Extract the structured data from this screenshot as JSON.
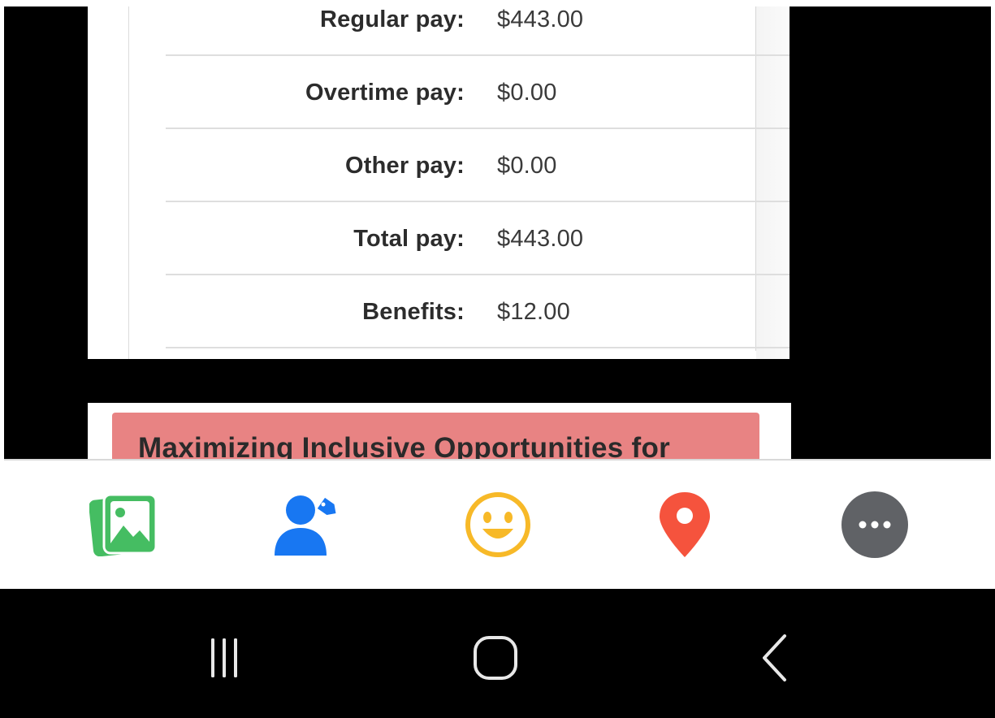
{
  "pay_details": {
    "rows": [
      {
        "label": "Regular pay:",
        "value": "$443.00"
      },
      {
        "label": "Overtime pay:",
        "value": "$0.00"
      },
      {
        "label": "Other pay:",
        "value": "$0.00"
      },
      {
        "label": "Total pay:",
        "value": "$443.00"
      },
      {
        "label": "Benefits:",
        "value": "$12.00"
      }
    ]
  },
  "next_card": {
    "banner_title": "Maximizing Inclusive Opportunities for",
    "banner_color": "#e88383"
  },
  "composer_toolbar": {
    "items": [
      {
        "icon": "photo-gallery-icon",
        "color": "#45bd62"
      },
      {
        "icon": "tag-people-icon",
        "color": "#1877f2"
      },
      {
        "icon": "feeling-smiley-icon",
        "color": "#f7b928"
      },
      {
        "icon": "check-in-location-icon",
        "color": "#f5533d"
      },
      {
        "icon": "more-options-icon",
        "color": "#606266"
      }
    ]
  },
  "system_nav": {
    "buttons": [
      "recent-apps-icon",
      "home-icon",
      "back-icon"
    ]
  }
}
